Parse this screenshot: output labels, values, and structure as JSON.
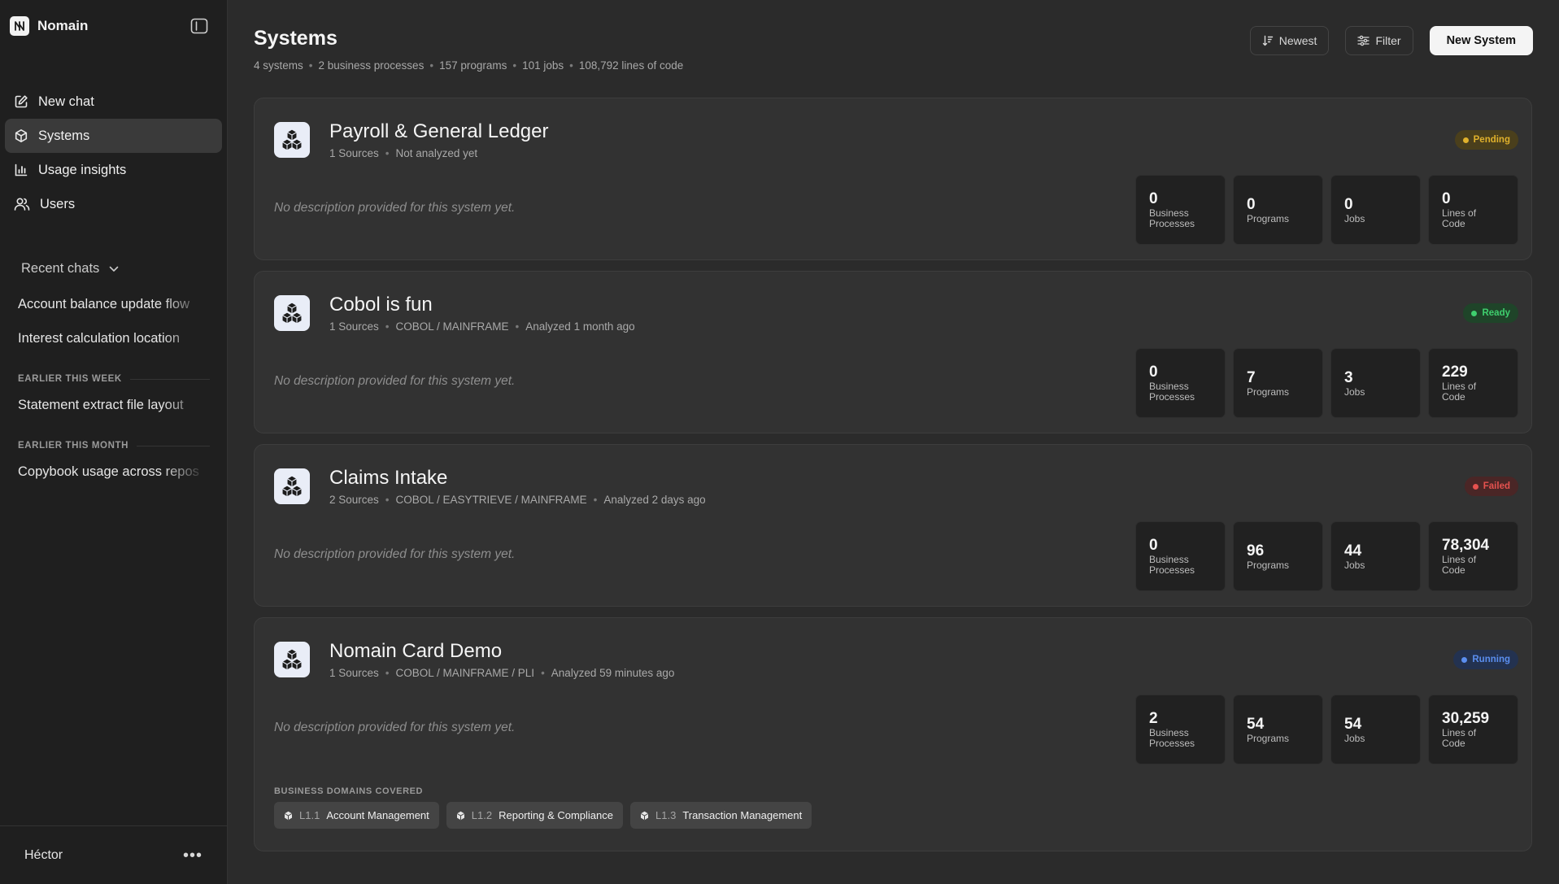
{
  "app": {
    "name": "Nomain"
  },
  "nav": [
    {
      "label": "New chat",
      "icon": "edit-icon"
    },
    {
      "label": "Systems",
      "icon": "hexagon-icon",
      "active": true
    },
    {
      "label": "Usage insights",
      "icon": "bar-chart-icon"
    },
    {
      "label": "Users",
      "icon": "users-icon"
    }
  ],
  "recent": {
    "header": "Recent chats",
    "groups": [
      {
        "title": "",
        "items": [
          "Account balance update flow",
          "Interest calculation location"
        ]
      },
      {
        "title": "EARLIER THIS WEEK",
        "items": [
          "Statement extract file layout"
        ]
      },
      {
        "title": "EARLIER THIS MONTH",
        "items": [
          "Copybook usage across repos"
        ]
      }
    ]
  },
  "user": {
    "name": "Héctor",
    "menu": "•••"
  },
  "page": {
    "title": "Systems",
    "stats": [
      "4 systems",
      "2 business processes",
      "157 programs",
      "101 jobs",
      "108,792 lines of code"
    ]
  },
  "toolbar": {
    "sort_label": "Newest",
    "filter_label": "Filter",
    "new_label": "New System"
  },
  "metric_labels": {
    "bp": [
      "Business",
      "Processes"
    ],
    "programs": [
      "Programs"
    ],
    "jobs": [
      "Jobs"
    ],
    "loc": [
      "Lines of",
      "Code"
    ]
  },
  "systems": [
    {
      "name": "Payroll & General Ledger",
      "meta": [
        "1 Sources",
        "Not analyzed yet"
      ],
      "status": "Pending",
      "status_color": "#e0b12c",
      "status_bg": "#4a3f1c",
      "description": "No description provided for this system yet.",
      "business_processes": "0",
      "programs": "0",
      "jobs": "0",
      "lines_of_code": "0",
      "domains": []
    },
    {
      "name": "Cobol is fun",
      "meta": [
        "1 Sources",
        "COBOL / MAINFRAME",
        "Analyzed 1 month ago"
      ],
      "status": "Ready",
      "status_color": "#3fcf6e",
      "status_bg": "#1f4429",
      "description": "No description provided for this system yet.",
      "business_processes": "0",
      "programs": "7",
      "jobs": "3",
      "lines_of_code": "229",
      "domains": []
    },
    {
      "name": "Claims Intake",
      "meta": [
        "2 Sources",
        "COBOL / EASYTRIEVE / MAINFRAME",
        "Analyzed 2 days ago"
      ],
      "status": "Failed",
      "status_color": "#e5524f",
      "status_bg": "#4a2626",
      "description": "No description provided for this system yet.",
      "business_processes": "0",
      "programs": "96",
      "jobs": "44",
      "lines_of_code": "78,304",
      "domains": []
    },
    {
      "name": "Nomain Card Demo",
      "meta": [
        "1 Sources",
        "COBOL / MAINFRAME / PLI",
        "Analyzed 59 minutes ago"
      ],
      "status": "Running",
      "status_color": "#5b8ff0",
      "status_bg": "#233250",
      "description": "No description provided for this system yet.",
      "business_processes": "2",
      "programs": "54",
      "jobs": "54",
      "lines_of_code": "30,259",
      "domains_title": "BUSINESS DOMAINS COVERED",
      "domains": [
        {
          "code": "L1.1",
          "label": "Account Management"
        },
        {
          "code": "L1.2",
          "label": "Reporting & Compliance"
        },
        {
          "code": "L1.3",
          "label": "Transaction Management"
        }
      ]
    }
  ]
}
